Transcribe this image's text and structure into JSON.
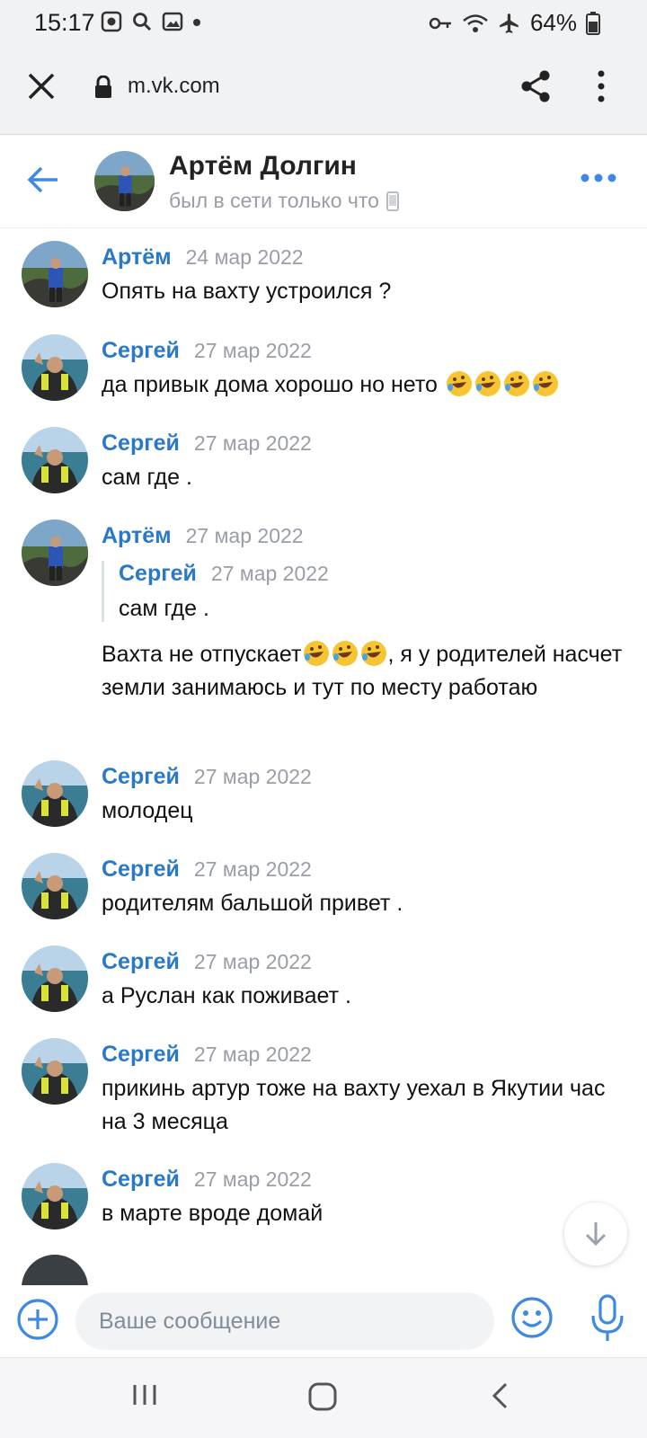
{
  "status_bar": {
    "time": "15:17",
    "battery": "64%",
    "icons": [
      "vpn-key-icon",
      "wifi-icon",
      "airplane-icon",
      "battery-icon"
    ]
  },
  "browser": {
    "url": "m.vk.com"
  },
  "chat_header": {
    "name": "Артём Долгин",
    "status": "был в сети только что"
  },
  "messages": [
    {
      "author": "Артём",
      "date": "24 мар 2022",
      "text": "Опять на вахту устроился ?",
      "avatar": "artem"
    },
    {
      "author": "Сергей",
      "date": "27 мар 2022",
      "text": "да привык дома хорошо но нето",
      "emoji_count": 4,
      "avatar": "sergey"
    },
    {
      "author": "Сергей",
      "date": "27 мар 2022",
      "text": "сам где .",
      "avatar": "sergey"
    },
    {
      "author": "Артём",
      "date": "27 мар 2022",
      "avatar": "artem",
      "quote": {
        "author": "Сергей",
        "date": "27 мар 2022",
        "text": "сам где ."
      },
      "text_before_emoji": "Вахта не отпускает",
      "text_after_emoji": ", я у родителей насчет земли занимаюсь и тут по месту работаю",
      "emoji_count": 3
    },
    {
      "author": "Сергей",
      "date": "27 мар 2022",
      "text": "молодец",
      "avatar": "sergey"
    },
    {
      "author": "Сергей",
      "date": "27 мар 2022",
      "text": "родителям бальшой привет .",
      "avatar": "sergey"
    },
    {
      "author": "Сергей",
      "date": "27 мар 2022",
      "text": "а Руслан как поживает .",
      "avatar": "sergey"
    },
    {
      "author": "Сергей",
      "date": "27 мар 2022",
      "text": "прикинь артур тоже на вахту уехал в Якутии час на 3 месяца",
      "avatar": "sergey"
    },
    {
      "author": "Сергей",
      "date": "27 мар 2022",
      "text": "в марте вроде домай",
      "avatar": "sergey"
    }
  ],
  "composer": {
    "placeholder": "Ваше сообщение"
  },
  "colors": {
    "accent": "#2a78c8",
    "icon_blue": "#3f8ae0",
    "muted": "#999ea6"
  }
}
